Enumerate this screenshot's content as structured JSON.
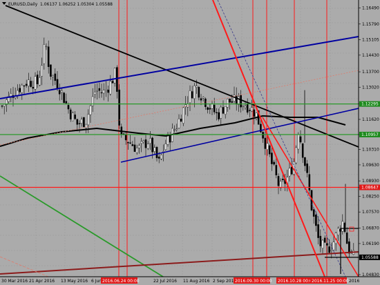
{
  "chart_header": {
    "symbol_timeframe": "EURUSD,Daily",
    "ohlc": "1.06137 1.06252 1.05304 1.05588"
  },
  "colors": {
    "background": "#ababab",
    "grid": "#999999",
    "bull_candle": "#ffffff",
    "bear_candle": "#000000",
    "trendline_black": "#000000",
    "channel_blue": "#0000a0",
    "level_green": "#2a9a2a",
    "line_red": "#ff1a1a",
    "line_darkred": "#8b1a1a",
    "dashed_salmon": "#e07a6a",
    "moving_average": "#000000",
    "price_marker_red": "#e01818",
    "price_marker_green": "#1e8a1e",
    "price_marker_black": "#000000",
    "date_marker_red": "#e01818"
  },
  "price_axis": {
    "ticks": [
      "1.16490",
      "1.15790",
      "1.15105",
      "1.14430",
      "1.13700",
      "1.13020",
      "1.12295",
      "1.11620",
      "1.10957",
      "1.10310",
      "1.09630",
      "1.08930",
      "1.08250",
      "1.08647",
      "1.07570",
      "1.06870",
      "1.06190",
      "1.05588",
      "1.04830"
    ],
    "markers": [
      {
        "text": "1.12295",
        "color": "green"
      },
      {
        "text": "1.10957",
        "color": "green"
      },
      {
        "text": "1.08647",
        "color": "red"
      },
      {
        "text": "1.05588",
        "color": "black"
      }
    ]
  },
  "time_axis": {
    "labels": [
      "30 Mar 2016",
      "21 Apr 2016",
      "13 May 2016",
      "6 Jun",
      "",
      "22 Jul 2016",
      "11 Aug 2016",
      "2 Sep 201",
      "",
      "",
      "",
      "2016"
    ],
    "date_markers": [
      "2016.06.24 00:00",
      "2016.09.30 00:00",
      "2016.10.28 00:00",
      "2016.11.25 00:00"
    ]
  },
  "chart_data": {
    "type": "candlestick",
    "symbol": "EURUSD",
    "timeframe": "Daily",
    "last_ohlc": {
      "open": 1.06137,
      "high": 1.06252,
      "low": 1.05304,
      "close": 1.05588
    },
    "ylim": [
      1.0483,
      1.1675
    ],
    "x": [
      "2016-03-30",
      "2016-04-21",
      "2016-05-13",
      "2016-06-06",
      "2016-06-24",
      "2016-07-22",
      "2016-08-11",
      "2016-09-02",
      "2016-09-30",
      "2016-10-28",
      "2016-11-25",
      "2016-12-13"
    ],
    "close": [
      1.131,
      1.134,
      1.131,
      1.1365,
      1.112,
      1.1015,
      1.124,
      1.117,
      1.1235,
      1.099,
      1.06,
      1.0559
    ],
    "horizontal_levels": [
      1.12295,
      1.10957,
      1.08647,
      1.05588
    ]
  }
}
